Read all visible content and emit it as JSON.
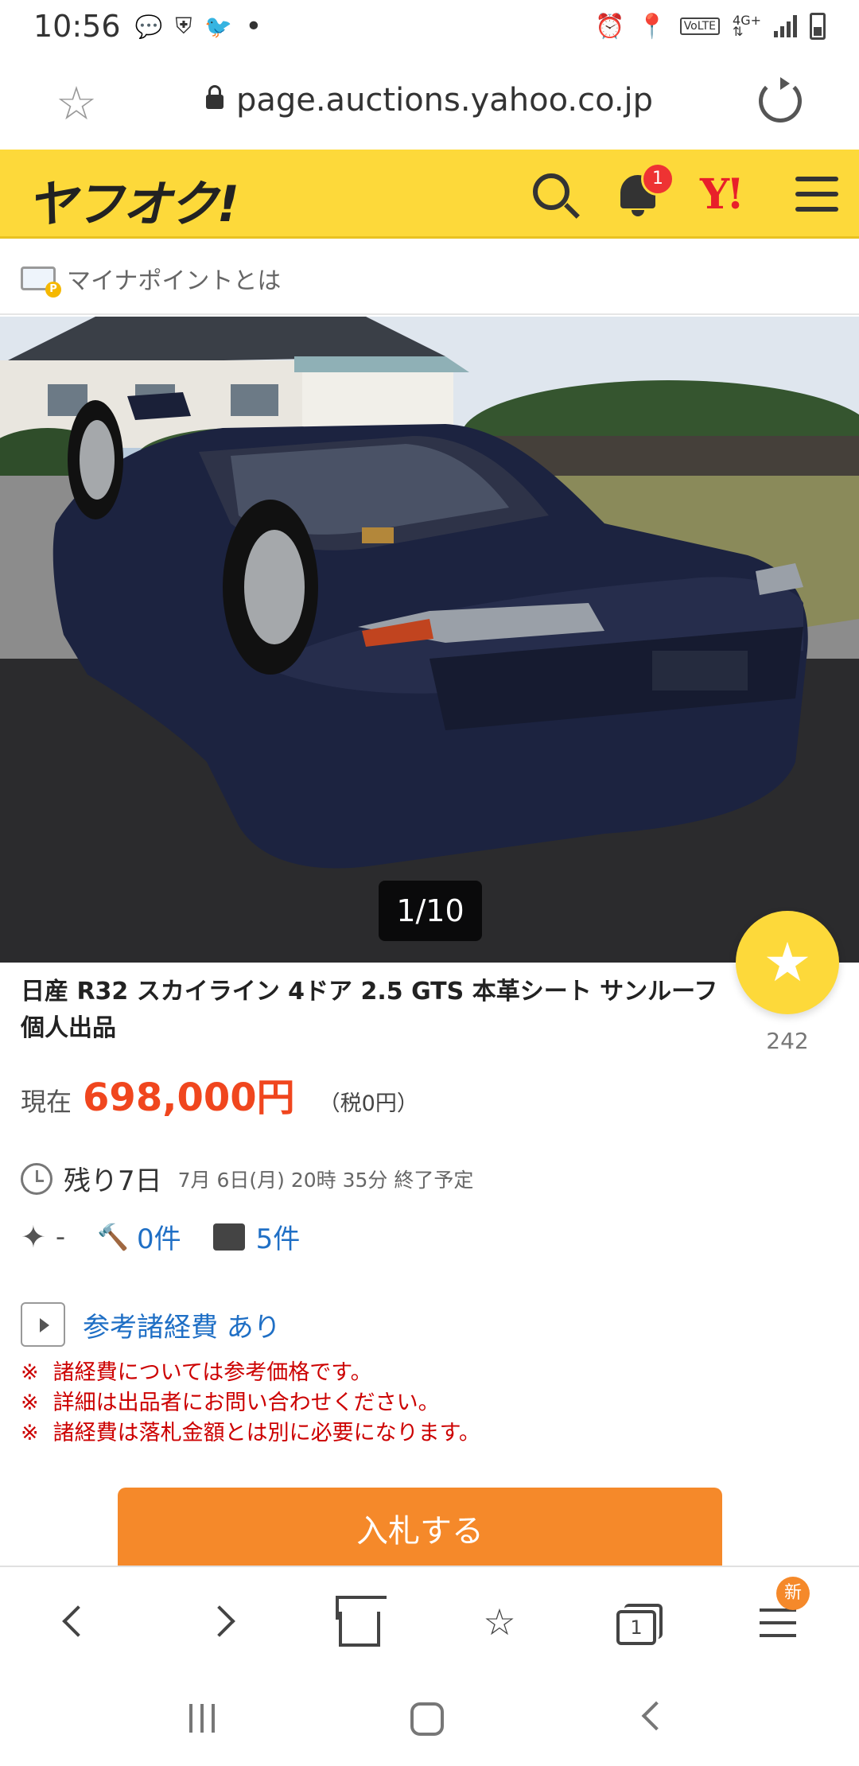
{
  "status_bar": {
    "time": "10:56",
    "dot": "•"
  },
  "browser": {
    "url": "page.auctions.yahoo.co.jp"
  },
  "header": {
    "logo": "ヤフオク!",
    "notification_count": "1",
    "yahoo_logo": "Y!"
  },
  "mynapoint": {
    "label": "マイナポイントとは"
  },
  "photo": {
    "counter": "1/10"
  },
  "item": {
    "title": "日産 R32 スカイライン 4ドア 2.5 GTS 本革シート サンルーフ 個人出品",
    "watch_count": "242",
    "price_label": "現在",
    "price": "698,000円",
    "tax": "（税0円）",
    "remaining": "残り7日",
    "end_date": "7月 6日(月) 20時 35分 終了予定",
    "rating": "-",
    "bids": "0件",
    "questions": "5件"
  },
  "fees": {
    "label": "参考諸経費 あり",
    "notes": [
      "諸経費については参考価格です。",
      "詳細は出品者にお問い合わせください。",
      "諸経費は落札金額とは別に必要になります。"
    ],
    "mark": "※"
  },
  "bid_button": {
    "label": "入札する"
  },
  "browser_bar": {
    "tab_count": "1",
    "new_badge": "新"
  },
  "colors": {
    "header_yellow": "#fdd93a",
    "price_red": "#f0461e",
    "link_blue": "#1f6fc5",
    "bid_orange": "#f5892a",
    "note_red": "#cc0000"
  }
}
